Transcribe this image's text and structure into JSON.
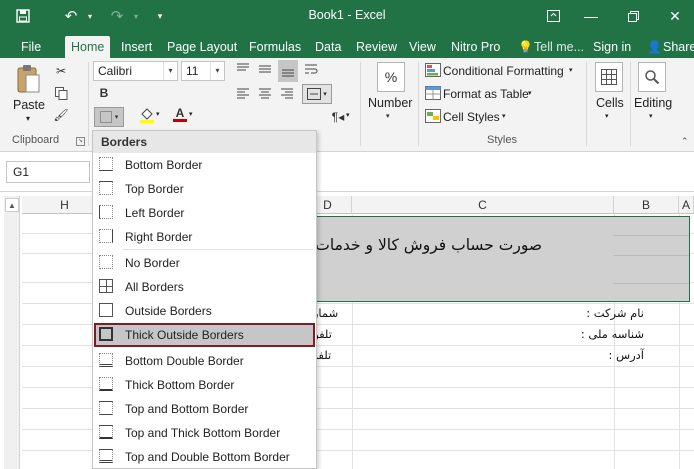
{
  "window": {
    "title": "Book1 - Excel",
    "accent_color": "#217346",
    "icons": [
      "save-icon",
      "undo-icon",
      "redo-icon",
      "customize-quick-access-icon",
      "ribbon-display-icon",
      "minimize-icon",
      "maximize-icon",
      "close-icon"
    ]
  },
  "tabs": {
    "file": "File",
    "home": "Home",
    "insert": "Insert",
    "page_layout": "Page Layout",
    "formulas": "Formulas",
    "data": "Data",
    "review": "Review",
    "view": "View",
    "nitro_pro": "Nitro Pro",
    "tell_me": "Tell me...",
    "sign_in": "Sign in",
    "share": "Share"
  },
  "ribbon": {
    "paste_label": "Paste",
    "clipboard_label": "Clipboard",
    "font_name": "Calibri",
    "font_size": "11",
    "number_label": "Number",
    "number_symbol": "%",
    "conditional_formatting": "Conditional Formatting",
    "format_as_table": "Format as Table",
    "cell_styles": "Cell Styles",
    "styles_label": "Styles",
    "cells_label": "Cells",
    "editing_label": "Editing",
    "font_color_hex": "#c00000",
    "fill_color_hex": "#ffff00"
  },
  "formula_bar": {
    "name_box": "G1"
  },
  "grid": {
    "columns": [
      "H",
      "D",
      "C",
      "B",
      "A"
    ],
    "merged_title": "صورت حساب فروش کالا و خدمات",
    "cells": {
      "company_name": "نام شرکت :",
      "national_id": "شناسه ملی :",
      "address": "آدرس :",
      "invoice_number": "شماره ا",
      "phone_1": "تلفن ثا",
      "phone_2": "تلفن ه"
    }
  },
  "borders_menu": {
    "header": "Borders",
    "items": [
      {
        "label": "Bottom Border",
        "icon": "bottom-border-icon"
      },
      {
        "label": "Top Border",
        "icon": "top-border-icon"
      },
      {
        "label": "Left Border",
        "icon": "left-border-icon"
      },
      {
        "label": "Right Border",
        "icon": "right-border-icon"
      },
      {
        "label": "No Border",
        "icon": "no-border-icon"
      },
      {
        "label": "All Borders",
        "icon": "all-borders-icon"
      },
      {
        "label": "Outside Borders",
        "icon": "outside-borders-icon"
      },
      {
        "label": "Thick Outside Borders",
        "icon": "thick-outside-borders-icon",
        "highlighted": true
      },
      {
        "label": "Bottom Double Border",
        "icon": "bottom-double-border-icon"
      },
      {
        "label": "Thick Bottom Border",
        "icon": "thick-bottom-border-icon"
      },
      {
        "label": "Top and Bottom Border",
        "icon": "top-and-bottom-border-icon"
      },
      {
        "label": "Top and Thick Bottom Border",
        "icon": "top-and-thick-bottom-border-icon"
      },
      {
        "label": "Top and Double Bottom Border",
        "icon": "top-and-double-bottom-border-icon"
      }
    ],
    "highlight_color": "#7a1d27"
  }
}
